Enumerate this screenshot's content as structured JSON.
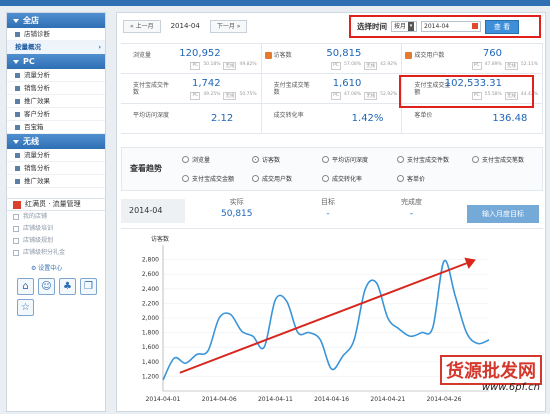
{
  "sidebar": {
    "sections": [
      {
        "title": "全店",
        "items": [
          "店铺诊断",
          "按量概况"
        ],
        "active_index": 1
      },
      {
        "title": "PC",
        "items": [
          "流量分析",
          "销售分析",
          "推广效果",
          "客户分析",
          "百宝箱"
        ]
      },
      {
        "title": "无线",
        "items": [
          "流量分析",
          "销售分析",
          "推广效果"
        ]
      }
    ],
    "tools_title": "红满贯 · 流量管理",
    "tools": [
      "我的店铺",
      "店铺级培训",
      "店铺级规划",
      "店铺级积分礼金"
    ],
    "settings_label": "设置中心"
  },
  "datebar": {
    "prev_label": "« 上一月",
    "current": "2014-04",
    "next_label": "下一月 »",
    "time_label": "选择时间",
    "granularity": "按月",
    "date_value": "2014-04",
    "query_label": "查 看"
  },
  "metrics": [
    {
      "name": "浏览量",
      "value": "120,952",
      "pc": "50.18%",
      "wireless": "49.82%"
    },
    {
      "name": "访客数",
      "value": "50,815",
      "pc": "57.08%",
      "wireless": "42.92%"
    },
    {
      "name": "成交用户数",
      "value": "760",
      "pc": "47.89%",
      "wireless": "52.11%"
    },
    {
      "name": "支付宝成交件数",
      "value": "1,742",
      "pc": "49.25%",
      "wireless": "50.75%"
    },
    {
      "name": "支付宝成交笔数",
      "value": "1,610",
      "pc": "47.08%",
      "wireless": "52.92%"
    },
    {
      "name": "支付宝成交金额",
      "value": "102,533.31",
      "pc": "55.58%",
      "wireless": "44.42%"
    },
    {
      "name": "平均访问深度",
      "value": "2.12"
    },
    {
      "name": "成交转化率",
      "value": "1.42%"
    },
    {
      "name": "客单价",
      "value": "136.48"
    }
  ],
  "metric_tags": {
    "pc": "PC",
    "wireless": "无线"
  },
  "trend": {
    "title": "查看趋势",
    "options": [
      "浏览量",
      "访客数",
      "平均访问深度",
      "支付宝成交件数",
      "支付宝成交笔数",
      "支付宝成交金额",
      "成交用户数",
      "成交转化率",
      "客单价"
    ],
    "selected": "访客数"
  },
  "compare": {
    "month": "2014-04",
    "actual_label": "实际",
    "actual_value": "50,815",
    "target_label": "目标",
    "target_value": "-",
    "completion_label": "完成度",
    "completion_value": "-",
    "enter_label": "输入月度目标"
  },
  "chart_data": {
    "type": "line",
    "ylabel": "访客数",
    "ylim": [
      1000,
      3000
    ],
    "yticks": [
      1200,
      1400,
      1600,
      1800,
      2000,
      2200,
      2400,
      2600,
      2800
    ],
    "xtick_labels": [
      "2014-04-01",
      "2014-04-06",
      "2014-04-11",
      "2014-04-16",
      "2014-04-21",
      "2014-04-26"
    ],
    "x": [
      "2014-04-01",
      "2014-04-02",
      "2014-04-03",
      "2014-04-04",
      "2014-04-05",
      "2014-04-06",
      "2014-04-07",
      "2014-04-08",
      "2014-04-09",
      "2014-04-10",
      "2014-04-11",
      "2014-04-12",
      "2014-04-13",
      "2014-04-14",
      "2014-04-15",
      "2014-04-16",
      "2014-04-17",
      "2014-04-18",
      "2014-04-19",
      "2014-04-20",
      "2014-04-21",
      "2014-04-22",
      "2014-04-23",
      "2014-04-24",
      "2014-04-25",
      "2014-04-26",
      "2014-04-27",
      "2014-04-28",
      "2014-04-29",
      "2014-04-30"
    ],
    "series": [
      {
        "values": [
          1150,
          1450,
          1380,
          1500,
          1550,
          2000,
          2050,
          1820,
          1750,
          1600,
          2250,
          2230,
          1800,
          1800,
          1700,
          1300,
          1480,
          1700,
          2400,
          2480,
          2000,
          1850,
          1750,
          1800,
          1870,
          2780,
          2300,
          1800,
          1650,
          1700
        ]
      }
    ],
    "colors": {
      "line": "#3a95d8",
      "arrow": "#d8261c"
    }
  },
  "watermark": {
    "text": "货源批发网",
    "site": "www.6pf.cn"
  }
}
